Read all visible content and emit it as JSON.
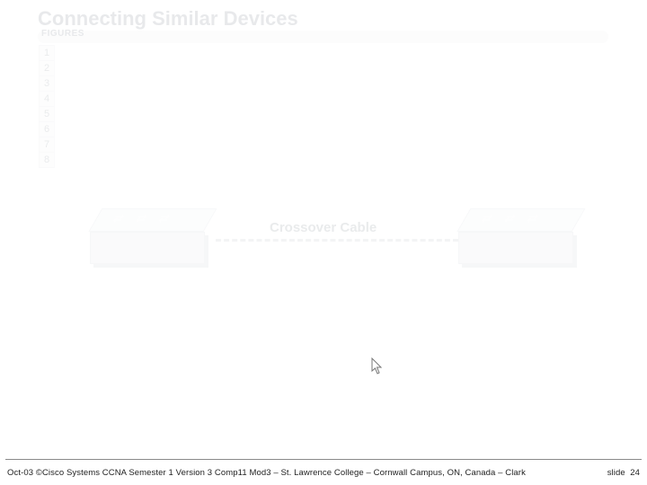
{
  "title": "Connecting Similar Devices",
  "figures_label": "FIGURES",
  "figures": [
    "1",
    "2",
    "3",
    "4",
    "5",
    "6",
    "7",
    "8"
  ],
  "cable_label": "Crossover Cable",
  "footer": {
    "left": "Oct-03 ©Cisco Systems CCNA Semester 1 Version 3 Comp11 Mod3 – St. Lawrence College – Cornwall Campus, ON, Canada – Clark",
    "slide_word": "slide",
    "slide_num": "24"
  }
}
